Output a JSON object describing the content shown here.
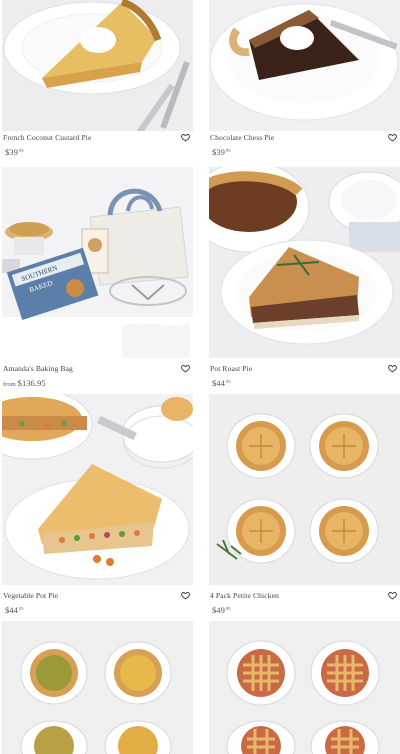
{
  "products": [
    {
      "title": "French Coconut Custard Pie",
      "price_main": "$39",
      "price_cents": "95",
      "from": ""
    },
    {
      "title": "Chocolate Chess Pie",
      "price_main": "$39",
      "price_cents": "95",
      "from": ""
    },
    {
      "title": "Amanda's Baking Bag",
      "price_main": "$136.95",
      "price_cents": "",
      "from": "from"
    },
    {
      "title": "Pot Roast Pie",
      "price_main": "$44",
      "price_cents": "95",
      "from": ""
    },
    {
      "title": "Vegetable Pot Pie",
      "price_main": "$44",
      "price_cents": "95",
      "from": ""
    },
    {
      "title": "4 Pack Petite Chicken",
      "price_main": "$49",
      "price_cents": "95",
      "from": ""
    }
  ],
  "cookbook": {
    "line1": "SOUTHERN",
    "line2": "BAKED"
  },
  "icons": {
    "favorite": "heart-outline-icon"
  },
  "colors": {
    "text": "#444444",
    "image_bg": "#f1f1f3",
    "crust": "#d9a65a"
  }
}
